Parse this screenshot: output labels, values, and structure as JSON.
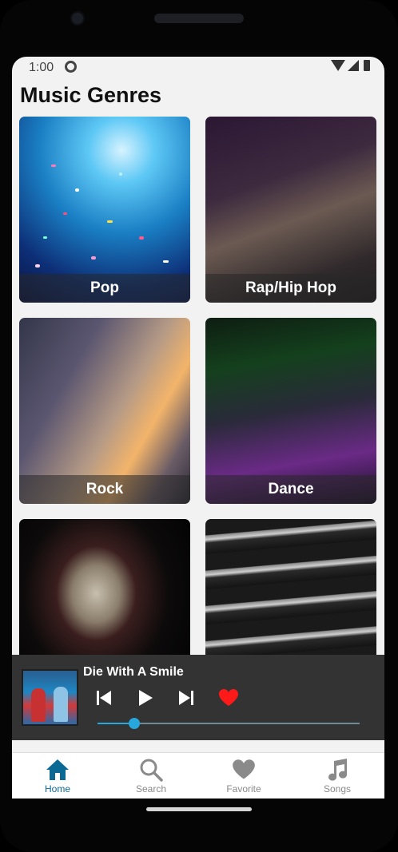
{
  "status_bar": {
    "time": "1:00"
  },
  "page": {
    "title": "Music Genres"
  },
  "genres": [
    {
      "label": "Pop"
    },
    {
      "label": "Rap/Hip Hop"
    },
    {
      "label": "Rock"
    },
    {
      "label": "Dance"
    },
    {
      "label": ""
    },
    {
      "label": ""
    }
  ],
  "player": {
    "song_title": "Die With A Smile",
    "progress": 0.14,
    "is_favorite": true,
    "accent_color": "#27a7dc",
    "heart_color": "#ff1a1a"
  },
  "bottom_nav": {
    "items": [
      {
        "label": "Home",
        "icon": "home-icon",
        "active": true
      },
      {
        "label": "Search",
        "icon": "search-icon",
        "active": false
      },
      {
        "label": "Favorite",
        "icon": "heart-icon",
        "active": false
      },
      {
        "label": "Songs",
        "icon": "music-note-icon",
        "active": false
      }
    ],
    "active_color": "#0b6a93",
    "inactive_color": "#8a8a8a"
  }
}
